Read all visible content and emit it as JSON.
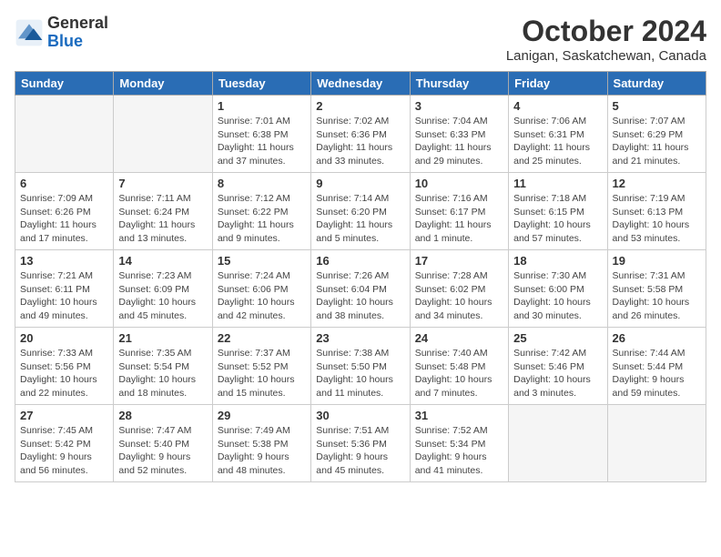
{
  "header": {
    "logo_general": "General",
    "logo_blue": "Blue",
    "title": "October 2024",
    "location": "Lanigan, Saskatchewan, Canada"
  },
  "days_of_week": [
    "Sunday",
    "Monday",
    "Tuesday",
    "Wednesday",
    "Thursday",
    "Friday",
    "Saturday"
  ],
  "weeks": [
    [
      null,
      null,
      {
        "day": 1,
        "sunrise": "7:01 AM",
        "sunset": "6:38 PM",
        "daylight": "11 hours and 37 minutes."
      },
      {
        "day": 2,
        "sunrise": "7:02 AM",
        "sunset": "6:36 PM",
        "daylight": "11 hours and 33 minutes."
      },
      {
        "day": 3,
        "sunrise": "7:04 AM",
        "sunset": "6:33 PM",
        "daylight": "11 hours and 29 minutes."
      },
      {
        "day": 4,
        "sunrise": "7:06 AM",
        "sunset": "6:31 PM",
        "daylight": "11 hours and 25 minutes."
      },
      {
        "day": 5,
        "sunrise": "7:07 AM",
        "sunset": "6:29 PM",
        "daylight": "11 hours and 21 minutes."
      }
    ],
    [
      {
        "day": 6,
        "sunrise": "7:09 AM",
        "sunset": "6:26 PM",
        "daylight": "11 hours and 17 minutes."
      },
      {
        "day": 7,
        "sunrise": "7:11 AM",
        "sunset": "6:24 PM",
        "daylight": "11 hours and 13 minutes."
      },
      {
        "day": 8,
        "sunrise": "7:12 AM",
        "sunset": "6:22 PM",
        "daylight": "11 hours and 9 minutes."
      },
      {
        "day": 9,
        "sunrise": "7:14 AM",
        "sunset": "6:20 PM",
        "daylight": "11 hours and 5 minutes."
      },
      {
        "day": 10,
        "sunrise": "7:16 AM",
        "sunset": "6:17 PM",
        "daylight": "11 hours and 1 minute."
      },
      {
        "day": 11,
        "sunrise": "7:18 AM",
        "sunset": "6:15 PM",
        "daylight": "10 hours and 57 minutes."
      },
      {
        "day": 12,
        "sunrise": "7:19 AM",
        "sunset": "6:13 PM",
        "daylight": "10 hours and 53 minutes."
      }
    ],
    [
      {
        "day": 13,
        "sunrise": "7:21 AM",
        "sunset": "6:11 PM",
        "daylight": "10 hours and 49 minutes."
      },
      {
        "day": 14,
        "sunrise": "7:23 AM",
        "sunset": "6:09 PM",
        "daylight": "10 hours and 45 minutes."
      },
      {
        "day": 15,
        "sunrise": "7:24 AM",
        "sunset": "6:06 PM",
        "daylight": "10 hours and 42 minutes."
      },
      {
        "day": 16,
        "sunrise": "7:26 AM",
        "sunset": "6:04 PM",
        "daylight": "10 hours and 38 minutes."
      },
      {
        "day": 17,
        "sunrise": "7:28 AM",
        "sunset": "6:02 PM",
        "daylight": "10 hours and 34 minutes."
      },
      {
        "day": 18,
        "sunrise": "7:30 AM",
        "sunset": "6:00 PM",
        "daylight": "10 hours and 30 minutes."
      },
      {
        "day": 19,
        "sunrise": "7:31 AM",
        "sunset": "5:58 PM",
        "daylight": "10 hours and 26 minutes."
      }
    ],
    [
      {
        "day": 20,
        "sunrise": "7:33 AM",
        "sunset": "5:56 PM",
        "daylight": "10 hours and 22 minutes."
      },
      {
        "day": 21,
        "sunrise": "7:35 AM",
        "sunset": "5:54 PM",
        "daylight": "10 hours and 18 minutes."
      },
      {
        "day": 22,
        "sunrise": "7:37 AM",
        "sunset": "5:52 PM",
        "daylight": "10 hours and 15 minutes."
      },
      {
        "day": 23,
        "sunrise": "7:38 AM",
        "sunset": "5:50 PM",
        "daylight": "10 hours and 11 minutes."
      },
      {
        "day": 24,
        "sunrise": "7:40 AM",
        "sunset": "5:48 PM",
        "daylight": "10 hours and 7 minutes."
      },
      {
        "day": 25,
        "sunrise": "7:42 AM",
        "sunset": "5:46 PM",
        "daylight": "10 hours and 3 minutes."
      },
      {
        "day": 26,
        "sunrise": "7:44 AM",
        "sunset": "5:44 PM",
        "daylight": "9 hours and 59 minutes."
      }
    ],
    [
      {
        "day": 27,
        "sunrise": "7:45 AM",
        "sunset": "5:42 PM",
        "daylight": "9 hours and 56 minutes."
      },
      {
        "day": 28,
        "sunrise": "7:47 AM",
        "sunset": "5:40 PM",
        "daylight": "9 hours and 52 minutes."
      },
      {
        "day": 29,
        "sunrise": "7:49 AM",
        "sunset": "5:38 PM",
        "daylight": "9 hours and 48 minutes."
      },
      {
        "day": 30,
        "sunrise": "7:51 AM",
        "sunset": "5:36 PM",
        "daylight": "9 hours and 45 minutes."
      },
      {
        "day": 31,
        "sunrise": "7:52 AM",
        "sunset": "5:34 PM",
        "daylight": "9 hours and 41 minutes."
      },
      null,
      null
    ]
  ]
}
